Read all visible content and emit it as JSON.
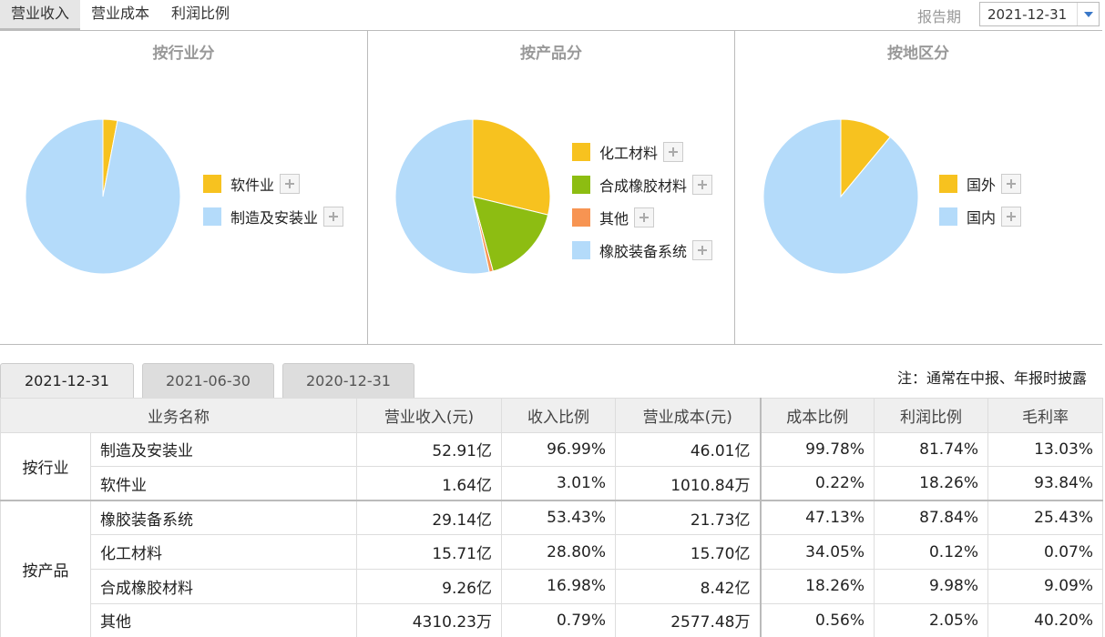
{
  "top_tabs": [
    "营业收入",
    "营业成本",
    "利润比例"
  ],
  "report": {
    "label": "报告期",
    "value": "2021-12-31"
  },
  "colors": {
    "yellow": "#f7c21f",
    "light_blue": "#b4dbfa",
    "green": "#8dbd12",
    "orange": "#f79452"
  },
  "chart_data": [
    {
      "type": "pie",
      "title": "按行业分",
      "labels": [
        "软件业",
        "制造及安装业"
      ],
      "values": [
        3.01,
        96.99
      ],
      "colors": [
        "#f7c21f",
        "#b4dbfa"
      ]
    },
    {
      "type": "pie",
      "title": "按产品分",
      "labels": [
        "化工材料",
        "合成橡胶材料",
        "其他",
        "橡胶装备系统"
      ],
      "values": [
        28.8,
        16.98,
        0.79,
        53.43
      ],
      "colors": [
        "#f7c21f",
        "#8dbd12",
        "#f79452",
        "#b4dbfa"
      ]
    },
    {
      "type": "pie",
      "title": "按地区分",
      "labels": [
        "国外",
        "国内"
      ],
      "values": [
        11,
        89
      ],
      "colors": [
        "#f7c21f",
        "#b4dbfa"
      ]
    }
  ],
  "period_tabs": [
    "2021-12-31",
    "2021-06-30",
    "2020-12-31"
  ],
  "note": "注：通常在中报、年报时披露",
  "table": {
    "headers": [
      "业务名称",
      "营业收入(元)",
      "收入比例",
      "营业成本(元)",
      "成本比例",
      "利润比例",
      "毛利率"
    ],
    "groups": [
      {
        "category": "按行业",
        "rows": [
          [
            "制造及安装业",
            "52.91亿",
            "96.99%",
            "46.01亿",
            "99.78%",
            "81.74%",
            "13.03%"
          ],
          [
            "软件业",
            "1.64亿",
            "3.01%",
            "1010.84万",
            "0.22%",
            "18.26%",
            "93.84%"
          ]
        ]
      },
      {
        "category": "按产品",
        "rows": [
          [
            "橡胶装备系统",
            "29.14亿",
            "53.43%",
            "21.73亿",
            "47.13%",
            "87.84%",
            "25.43%"
          ],
          [
            "化工材料",
            "15.71亿",
            "28.80%",
            "15.70亿",
            "34.05%",
            "0.12%",
            "0.07%"
          ],
          [
            "合成橡胶材料",
            "9.26亿",
            "16.98%",
            "8.42亿",
            "18.26%",
            "9.98%",
            "9.09%"
          ],
          [
            "其他",
            "4310.23万",
            "0.79%",
            "2577.48万",
            "0.56%",
            "2.05%",
            "40.20%"
          ]
        ]
      }
    ]
  }
}
